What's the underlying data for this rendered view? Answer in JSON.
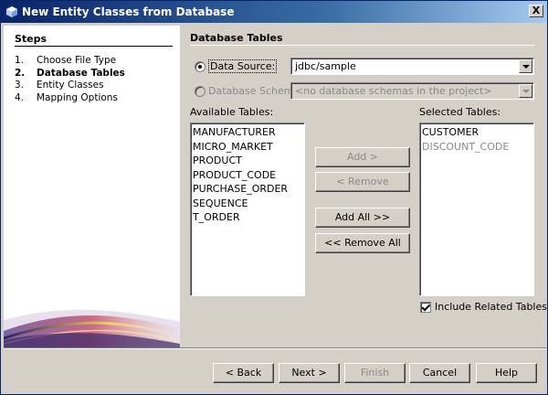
{
  "window": {
    "title": "New Entity Classes from Database",
    "close_label": "X"
  },
  "steps": {
    "title": "Steps",
    "items": [
      {
        "num": "1.",
        "label": "Choose File Type"
      },
      {
        "num": "2.",
        "label": "Database Tables"
      },
      {
        "num": "3.",
        "label": "Entity Classes"
      },
      {
        "num": "4.",
        "label": "Mapping Options"
      }
    ]
  },
  "panel": {
    "title": "Database Tables",
    "data_source_label": "Data Source:",
    "data_source_value": "jdbc/sample",
    "data_source_selected": true,
    "db_schema_label": "Database Schema",
    "db_schema_value": "<no database schemas in the project>",
    "available_label": "Available Tables:",
    "available_tables": [
      "MANUFACTURER",
      "MICRO_MARKET",
      "PRODUCT",
      "PRODUCT_CODE",
      "PURCHASE_ORDER",
      "SEQUENCE",
      "T_ORDER"
    ],
    "selected_label": "Selected Tables:",
    "selected_tables": [
      {
        "name": "CUSTOMER",
        "enabled": true
      },
      {
        "name": "DISCOUNT_CODE",
        "enabled": false
      }
    ],
    "add_label": "Add >",
    "remove_label": "< Remove",
    "add_all_label": "Add All >>",
    "remove_all_label": "<< Remove All",
    "include_related_label": "Include Related Tables",
    "include_related_checked": true
  },
  "footer": {
    "back_label": "< Back",
    "next_label": "Next >",
    "finish_label": "Finish",
    "cancel_label": "Cancel",
    "help_label": "Help"
  }
}
